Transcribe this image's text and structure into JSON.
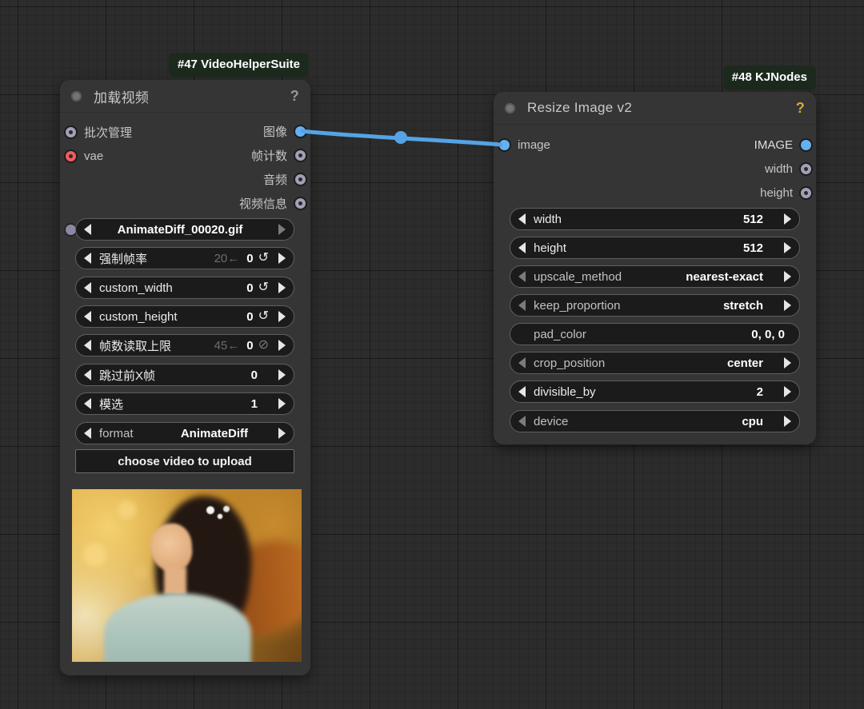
{
  "colors": {
    "canvas_bg": "#2c2c2c",
    "node_bg": "#353535",
    "badge_bg": "#1c2a1e",
    "widget_bg": "#1b1b1b",
    "link_blue": "#55a3e6",
    "slot_blue": "#63b1f1",
    "slot_gray": "#a59fb6",
    "slot_red": "#f25d5d",
    "help_gold": "#d2a93c"
  },
  "icons": {
    "help": "?",
    "undo": "↺",
    "no_limit": "⊘"
  },
  "node_47": {
    "badge": "#47 VideoHelperSuite",
    "title": "加载视频",
    "inputs": [
      {
        "label": "批次管理"
      },
      {
        "label": "vae"
      }
    ],
    "outputs": [
      {
        "label": "图像"
      },
      {
        "label": "帧计数"
      },
      {
        "label": "音频"
      },
      {
        "label": "视频信息"
      }
    ],
    "widgets": [
      {
        "label": "AnimateDiff_00020.gif"
      },
      {
        "label": "强制帧率",
        "ghost": "20←",
        "value": "0"
      },
      {
        "label": "custom_width",
        "value": "0"
      },
      {
        "label": "custom_height",
        "value": "0"
      },
      {
        "label": "帧数读取上限",
        "ghost": "45←",
        "value": "0"
      },
      {
        "label": "跳过前X帧",
        "value": "0"
      },
      {
        "label": "模选",
        "value": "1"
      },
      {
        "label": "format",
        "value": "AnimateDiff"
      }
    ],
    "upload_button": "choose video to upload"
  },
  "node_48": {
    "badge": "#48 KJNodes",
    "title": "Resize Image v2",
    "inputs": [
      {
        "label": "image"
      }
    ],
    "outputs": [
      {
        "label": "IMAGE"
      },
      {
        "label": "width"
      },
      {
        "label": "height"
      }
    ],
    "widgets": [
      {
        "label": "width",
        "value": "512"
      },
      {
        "label": "height",
        "value": "512"
      },
      {
        "label": "upscale_method",
        "value": "nearest-exact"
      },
      {
        "label": "keep_proportion",
        "value": "stretch"
      },
      {
        "label": "pad_color",
        "value": "0, 0, 0"
      },
      {
        "label": "crop_position",
        "value": "center"
      },
      {
        "label": "divisible_by",
        "value": "2"
      },
      {
        "label": "device",
        "value": "cpu"
      }
    ]
  }
}
